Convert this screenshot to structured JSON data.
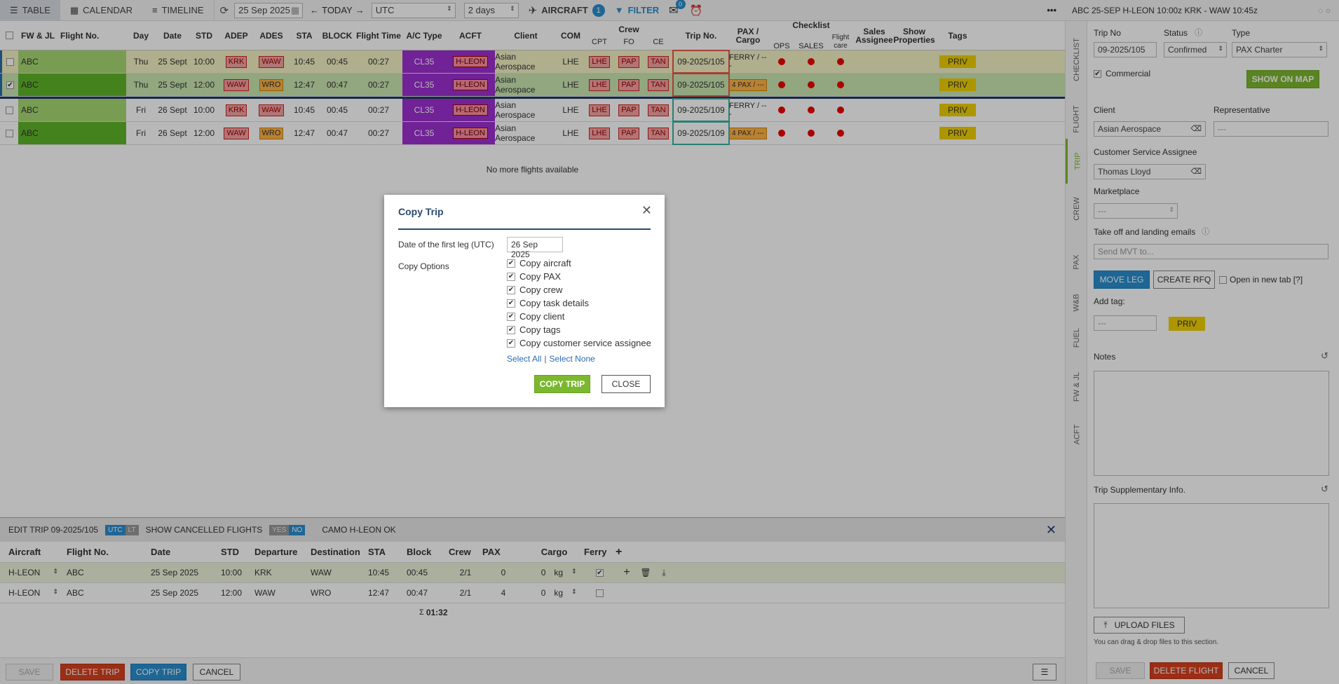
{
  "toolbar": {
    "table": "TABLE",
    "calendar": "CALENDAR",
    "timeline": "TIMELINE",
    "date": "25 Sep 2025",
    "today": "TODAY",
    "timezone": "UTC",
    "range": "2 days",
    "aircraft": "AIRCRAFT",
    "aircraft_count": "1",
    "filter": "FILTER",
    "mail_count": "0",
    "more": "•••"
  },
  "table": {
    "headers": [
      "FW & JL",
      "Flight No.",
      "Day",
      "Date",
      "STD",
      "ADEP",
      "ADES",
      "STA",
      "BLOCK",
      "Flight Time",
      "A/C Type",
      "ACFT",
      "Client",
      "COM",
      "Crew",
      "CPT",
      "FO",
      "CE",
      "Trip No.",
      "PAX / Cargo",
      "Checklist",
      "OPS",
      "SALES",
      "Flight care",
      "Sales Assignee",
      "Show Properties",
      "Tags"
    ],
    "rows": [
      {
        "checked": "",
        "fw": "ABC",
        "day": "Thu",
        "date": "25 Sept",
        "std": "10:00",
        "adep": "KRK",
        "ades": "WAW",
        "sta": "10:45",
        "block": "00:45",
        "ft": "00:27",
        "ac": "CL35",
        "acft": "H-LEON",
        "client": "Asian Aerospace",
        "com": "LHE",
        "cpt": "LHE",
        "fo": "PAP",
        "ce": "TAN",
        "trip": "09-2025/105",
        "pax": "FERRY / ---",
        "tag": "PRIV"
      },
      {
        "checked": "✔",
        "fw": "ABC",
        "day": "Thu",
        "date": "25 Sept",
        "std": "12:00",
        "adep": "WAW",
        "ades": "WRO",
        "sta": "12:47",
        "block": "00:47",
        "ft": "00:27",
        "ac": "CL35",
        "acft": "H-LEON",
        "client": "Asian Aerospace",
        "com": "LHE",
        "cpt": "LHE",
        "fo": "PAP",
        "ce": "TAN",
        "trip": "09-2025/105",
        "pax": "4 PAX / ---",
        "tag": "PRIV"
      },
      {
        "checked": "",
        "fw": "ABC",
        "day": "Fri",
        "date": "26 Sept",
        "std": "10:00",
        "adep": "KRK",
        "ades": "WAW",
        "sta": "10:45",
        "block": "00:45",
        "ft": "00:27",
        "ac": "CL35",
        "acft": "H-LEON",
        "client": "Asian Aerospace",
        "com": "LHE",
        "cpt": "LHE",
        "fo": "PAP",
        "ce": "TAN",
        "trip": "09-2025/109",
        "pax": "FERRY / ---",
        "tag": "PRIV"
      },
      {
        "checked": "",
        "fw": "ABC",
        "day": "Fri",
        "date": "26 Sept",
        "std": "12:00",
        "adep": "WAW",
        "ades": "WRO",
        "sta": "12:47",
        "block": "00:47",
        "ft": "00:27",
        "ac": "CL35",
        "acft": "H-LEON",
        "client": "Asian Aerospace",
        "com": "LHE",
        "cpt": "LHE",
        "fo": "PAP",
        "ce": "TAN",
        "trip": "09-2025/109",
        "pax": "4 PAX / ---",
        "tag": "PRIV"
      }
    ],
    "no_more": "No more flights available"
  },
  "modal": {
    "title": "Copy Trip",
    "date_label": "Date of the first leg (UTC)",
    "date_value": "26 Sep 2025",
    "options_label": "Copy Options",
    "options": [
      "Copy aircraft",
      "Copy PAX",
      "Copy crew",
      "Copy task details",
      "Copy client",
      "Copy tags",
      "Copy customer service assignee"
    ],
    "select_all": "Select All",
    "separator": "|",
    "select_none": "Select None",
    "copy_btn": "COPY TRIP",
    "close_btn": "CLOSE"
  },
  "editor": {
    "title": "EDIT TRIP 09-2025/105",
    "utc": "UTC",
    "lt": "LT",
    "show_cancelled": "SHOW CANCELLED FLIGHTS",
    "yes": "YES",
    "no": "NO",
    "camo": "CAMO H-LEON OK",
    "columns": [
      "Aircraft",
      "Flight No.",
      "Date",
      "STD",
      "Departure",
      "Destination",
      "STA",
      "Block",
      "Crew",
      "PAX",
      "Cargo",
      "Ferry"
    ],
    "rows": [
      {
        "aircraft": "H-LEON",
        "flight": "ABC",
        "date": "25 Sep 2025",
        "std": "10:00",
        "dep": "KRK",
        "dest": "WAW",
        "sta": "10:45",
        "block": "00:45",
        "crew": "2/1",
        "pax": "0",
        "cargo": "0",
        "unit": "kg",
        "ferry": "✔"
      },
      {
        "aircraft": "H-LEON",
        "flight": "ABC",
        "date": "25 Sep 2025",
        "std": "12:00",
        "dep": "WAW",
        "dest": "WRO",
        "sta": "12:47",
        "block": "00:47",
        "crew": "2/1",
        "pax": "4",
        "cargo": "0",
        "unit": "kg",
        "ferry": ""
      }
    ],
    "total_symbol": "Σ",
    "total": "01:32",
    "save": "SAVE",
    "delete": "DELETE TRIP",
    "copy": "COPY TRIP",
    "cancel": "CANCEL"
  },
  "side": {
    "header": "ABC  25-SEP  H-LEON 10:00z KRK - WAW 10:45z",
    "tabs": [
      "CHECKLIST",
      "FLIGHT",
      "TRIP",
      "CREW",
      "PAX",
      "W&B",
      "FUEL",
      "FW & JL",
      "ACFT"
    ],
    "trip_no_label": "Trip No",
    "trip_no": "09-2025/105",
    "status_label": "Status",
    "status": "Confirmed",
    "type_label": "Type",
    "type": "PAX Charter",
    "commercial": "Commercial",
    "show_on_map": "SHOW ON MAP",
    "client_label": "Client",
    "client": "Asian Aerospace",
    "rep_label": "Representative",
    "rep": "---",
    "csa_label": "Customer Service Assignee",
    "csa": "Thomas Lloyd",
    "marketplace_label": "Marketplace",
    "marketplace": "---",
    "emails_label": "Take off and landing emails",
    "emails_placeholder": "Send MVT to...",
    "move_leg": "MOVE LEG",
    "create_rfq": "CREATE RFQ",
    "open_new_tab": "Open in new tab [?]",
    "add_tag_label": "Add tag:",
    "add_tag": "---",
    "tag": "PRIV",
    "notes_label": "Notes",
    "supp_label": "Trip Supplementary Info.",
    "upload": "UPLOAD FILES",
    "drag_hint": "You can drag & drop files to this section.",
    "save": "SAVE",
    "delete": "DELETE FLIGHT",
    "cancel": "CANCEL"
  },
  "colors": {
    "accent_blue": "#2a8ecf",
    "accent_green": "#7cb82f",
    "danger_red": "#d9401e",
    "acft_purple": "#9b30d0",
    "highlight_red_box": "#e8574a",
    "highlight_teal_box": "#3bb2a0"
  }
}
